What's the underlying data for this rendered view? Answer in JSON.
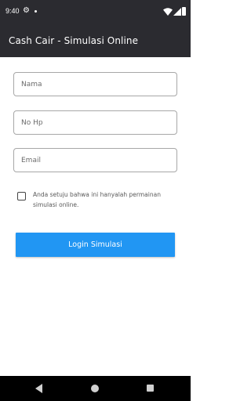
{
  "status_bar": {
    "time": "9:40",
    "icons": [
      "gear-icon",
      "notification-dot-icon",
      "wifi-icon",
      "signal-icon",
      "battery-icon"
    ]
  },
  "app_bar": {
    "title": "Cash Cair - Simulasi Online"
  },
  "form": {
    "name_placeholder": "Nama",
    "phone_placeholder": "No Hp",
    "email_placeholder": "Email",
    "name_value": "",
    "phone_value": "",
    "email_value": "",
    "consent_text": "Anda setuju bahwa ini hanyalah permainan simulasi online.",
    "consent_checked": false,
    "login_label": "Login Simulasi"
  },
  "nav_bar": {
    "icons": [
      "back-icon",
      "home-icon",
      "recents-icon"
    ]
  },
  "colors": {
    "toolbar": "#2b2b30",
    "primary_button": "#2196f3",
    "field_border": "#a7a7a7"
  }
}
